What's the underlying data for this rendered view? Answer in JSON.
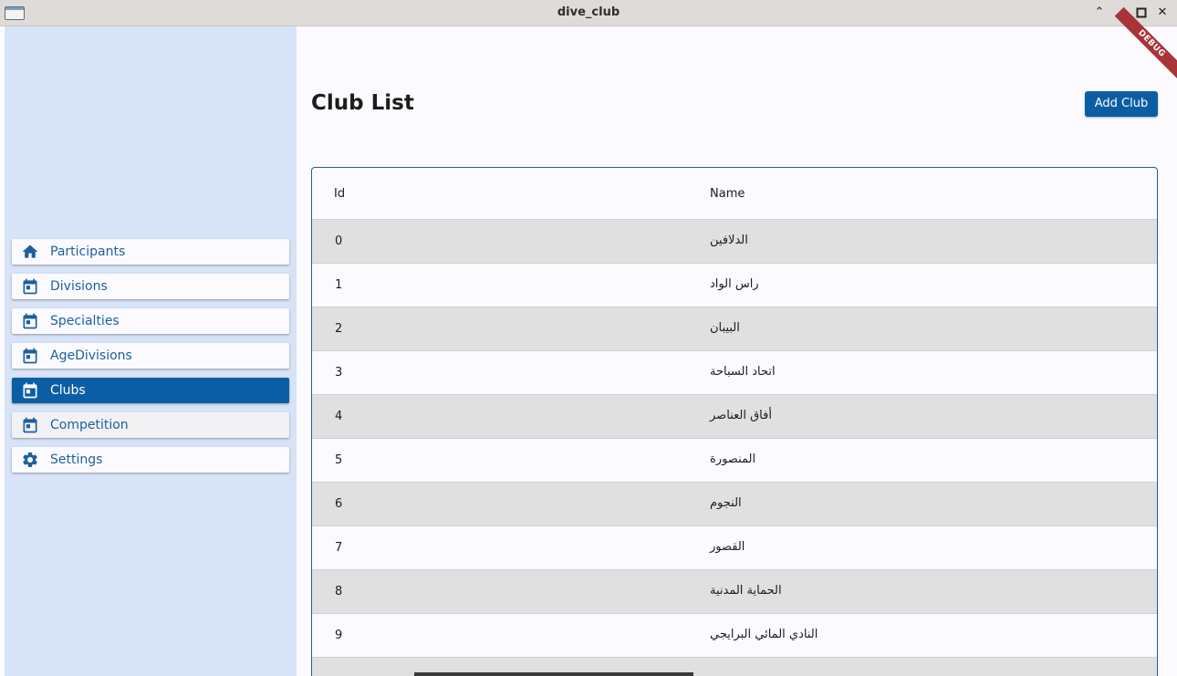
{
  "window": {
    "title": "dive_club"
  },
  "sidebar": {
    "items": [
      {
        "label": "Participants",
        "icon": "home-icon"
      },
      {
        "label": "Divisions",
        "icon": "calendar-icon"
      },
      {
        "label": "Specialties",
        "icon": "calendar-icon"
      },
      {
        "label": "AgeDivisions",
        "icon": "calendar-icon"
      },
      {
        "label": "Clubs",
        "icon": "calendar-icon",
        "active": true
      },
      {
        "label": "Competition",
        "icon": "calendar-icon"
      },
      {
        "label": "Settings",
        "icon": "gear-icon"
      }
    ]
  },
  "main": {
    "title": "Club List",
    "add_button": "Add Club",
    "debug_banner": "DEBUG",
    "table": {
      "headers": {
        "id": "Id",
        "name": "Name"
      },
      "rows": [
        {
          "id": "0",
          "name": "الدلافين"
        },
        {
          "id": "1",
          "name": "راس الواد"
        },
        {
          "id": "2",
          "name": "البيبان"
        },
        {
          "id": "3",
          "name": "اتحاد السباحة"
        },
        {
          "id": "4",
          "name": "أفاق العناصر"
        },
        {
          "id": "5",
          "name": "المنصورة"
        },
        {
          "id": "6",
          "name": "النجوم"
        },
        {
          "id": "7",
          "name": "القصور"
        },
        {
          "id": "8",
          "name": "الحماية المدنية"
        },
        {
          "id": "9",
          "name": "النادي المائي البرايجي"
        }
      ]
    }
  },
  "colors": {
    "accent": "#0c5ea4",
    "sidebar_bg": "#d7e3f6",
    "row_alt": "#e0e0e0"
  }
}
